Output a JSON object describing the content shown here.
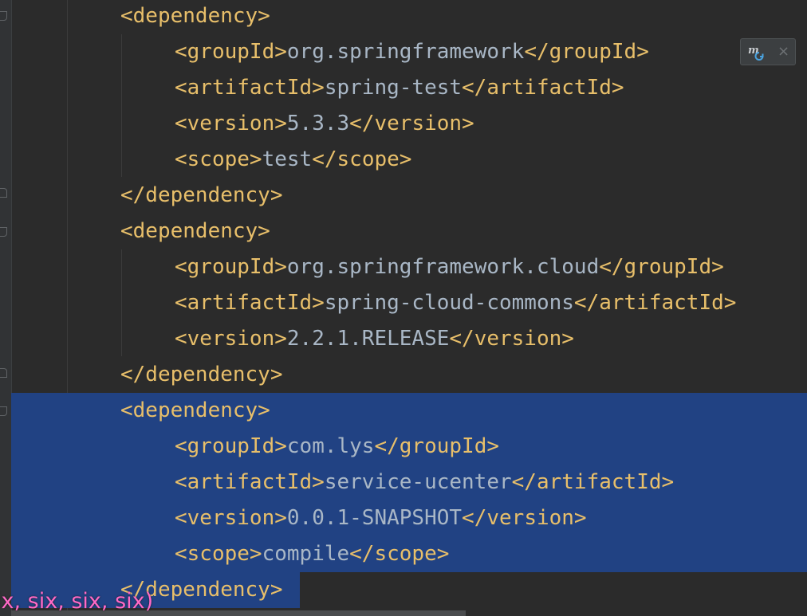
{
  "code_lines": [
    {
      "indent": 2,
      "tag_open": "<dependency>",
      "value": "",
      "tag_close": ""
    },
    {
      "indent": 3,
      "tag_open": "<groupId>",
      "value": "org.springframework",
      "tag_close": "</groupId>"
    },
    {
      "indent": 3,
      "tag_open": "<artifactId>",
      "value": "spring-test",
      "tag_close": "</artifactId>"
    },
    {
      "indent": 3,
      "tag_open": "<version>",
      "value": "5.3.3",
      "tag_close": "</version>"
    },
    {
      "indent": 3,
      "tag_open": "<scope>",
      "value": "test",
      "tag_close": "</scope>"
    },
    {
      "indent": 2,
      "tag_open": "</dependency>",
      "value": "",
      "tag_close": ""
    },
    {
      "indent": 2,
      "tag_open": "<dependency>",
      "value": "",
      "tag_close": ""
    },
    {
      "indent": 3,
      "tag_open": "<groupId>",
      "value": "org.springframework.cloud",
      "tag_close": "</groupId>"
    },
    {
      "indent": 3,
      "tag_open": "<artifactId>",
      "value": "spring-cloud-commons",
      "tag_close": "</artifactId>"
    },
    {
      "indent": 3,
      "tag_open": "<version>",
      "value": "2.2.1.RELEASE",
      "tag_close": "</version>"
    },
    {
      "indent": 2,
      "tag_open": "</dependency>",
      "value": "",
      "tag_close": ""
    },
    {
      "indent": 2,
      "tag_open": "<dependency>",
      "value": "",
      "tag_close": "",
      "selected": "full"
    },
    {
      "indent": 3,
      "tag_open": "<groupId>",
      "value": "com.lys",
      "tag_close": "</groupId>",
      "selected": "full"
    },
    {
      "indent": 3,
      "tag_open": "<artifactId>",
      "value": "service-ucenter",
      "tag_close": "</artifactId>",
      "selected": "full"
    },
    {
      "indent": 3,
      "tag_open": "<version>",
      "value": "0.0.1-SNAPSHOT",
      "tag_close": "</version>",
      "selected": "full"
    },
    {
      "indent": 3,
      "tag_open": "<scope>",
      "value": "compile",
      "tag_close": "</scope>",
      "selected": "full"
    },
    {
      "indent": 2,
      "tag_open": "</dependency>",
      "value": "",
      "tag_close": "",
      "selected": "partial"
    }
  ],
  "maven_popup": {
    "icon": "maven-reload-icon",
    "close_glyph": "×"
  },
  "overlay_text": "ix, six, six, six)",
  "colors": {
    "background": "#2b2b2b",
    "selection": "#214283",
    "xml_tag": "#e8bf6a",
    "xml_text": "#a9b7c6",
    "overlay_text": "#ff69c7"
  }
}
